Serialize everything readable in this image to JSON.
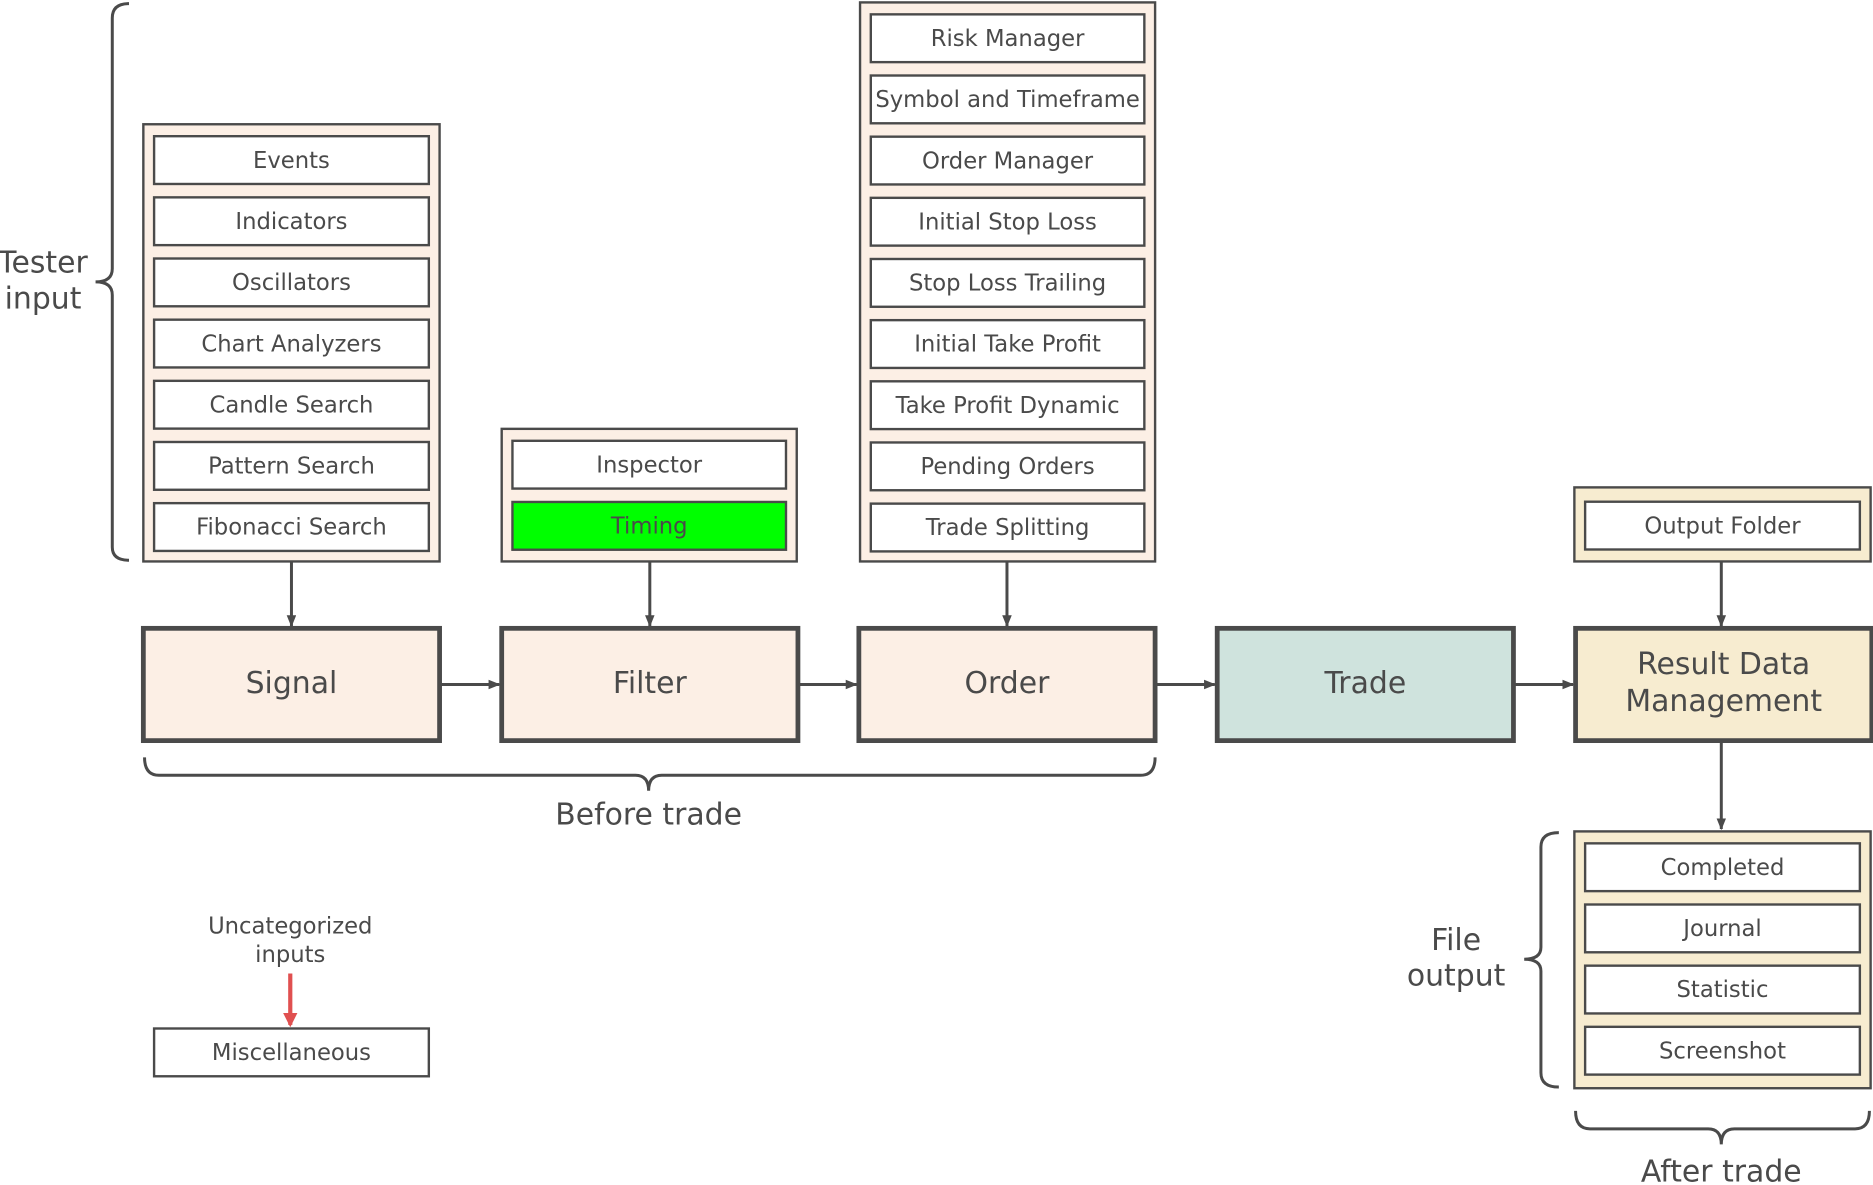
{
  "colors": {
    "stroke": "#4a4a4a",
    "group_fill": "#fcefe5",
    "trade_fill": "#cfe3dd",
    "result_fill": "#f7ecd0",
    "highlight": "#00ff00",
    "red_arrow": "#e05050"
  },
  "groups": {
    "signal_inputs": [
      "Events",
      "Indicators",
      "Oscillators",
      "Chart Analyzers",
      "Candle Search",
      "Pattern Search",
      "Fibonacci Search"
    ],
    "filter_inputs": [
      "Inspector",
      "Timing"
    ],
    "order_inputs": [
      "Risk Manager",
      "Symbol and Timeframe",
      "Order Manager",
      "Initial Stop Loss",
      "Stop Loss Trailing",
      "Initial Take Profit",
      "Take Profit Dynamic",
      "Pending Orders",
      "Trade Splitting"
    ],
    "result_inputs": [
      "Output Folder"
    ],
    "file_outputs": [
      "Completed",
      "Journal",
      "Statistic",
      "Screenshot"
    ]
  },
  "stages": {
    "signal": "Signal",
    "filter": "Filter",
    "order": "Order",
    "trade": "Trade",
    "result_line1": "Result Data",
    "result_line2": "Management"
  },
  "labels": {
    "tester_input_1": "Tester",
    "tester_input_2": "input",
    "before_trade": "Before trade",
    "after_trade": "After trade",
    "file_output_1": "File",
    "file_output_2": "output",
    "uncategorized_1": "Uncategorized",
    "uncategorized_2": "inputs",
    "miscellaneous": "Miscellaneous"
  }
}
